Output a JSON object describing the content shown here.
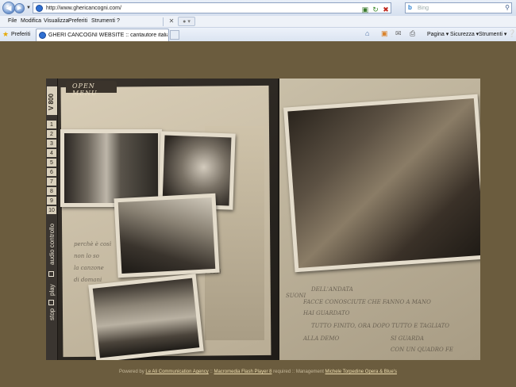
{
  "browser": {
    "url": "http://www.ghericancogni.com/",
    "search_placeholder": "Bing",
    "search_logo": "b",
    "menu": [
      "File",
      "Modifica",
      "Visualizza",
      "Preferiti",
      "Strumenti",
      "?"
    ],
    "favorites_label": "Preferiti",
    "tab_title": "GHERI CANCOGNI WEBSITE :: cantautore italiano mu...",
    "commands": {
      "page": "Pagina",
      "security": "Sicurezza",
      "tools": "Strumenti"
    }
  },
  "site": {
    "open_menu": "OPEN MENU",
    "sidebar_label": "V 800",
    "numbers": [
      "1",
      "2",
      "3",
      "4",
      "5",
      "6",
      "7",
      "8",
      "9",
      "10"
    ],
    "audio_label": "audio controllo",
    "play_label": "play",
    "stop_label": "stop",
    "scribbles_left": [
      "perchè è così",
      "non lo so",
      "la canzone",
      "di domani",
      "è così"
    ],
    "scribbles_right": [
      "DELL'ANDATA",
      "FACCE CONOSCIUTE CHE FANNO A MANO",
      "HAI GUARDATO",
      "SUONI",
      "TUTTO FINITO, ORA DOPO TUTTO E TAGLIATO",
      "ALLA DEMO",
      "SI GUARDA",
      "CON UN QUADRO FE"
    ]
  },
  "footer": {
    "powered_prefix": "Powered by",
    "agency": "Le Ali Communication Agency",
    "flash": "Macromedia Flash Player 8",
    "required": "required",
    "management_prefix": "Management",
    "management": "Michele Torpedine Opera & Blue's"
  },
  "colors": {
    "page_bg": "#6b5c3e",
    "flash_bg": "#2b2723",
    "paper": "#d8cdb6"
  }
}
